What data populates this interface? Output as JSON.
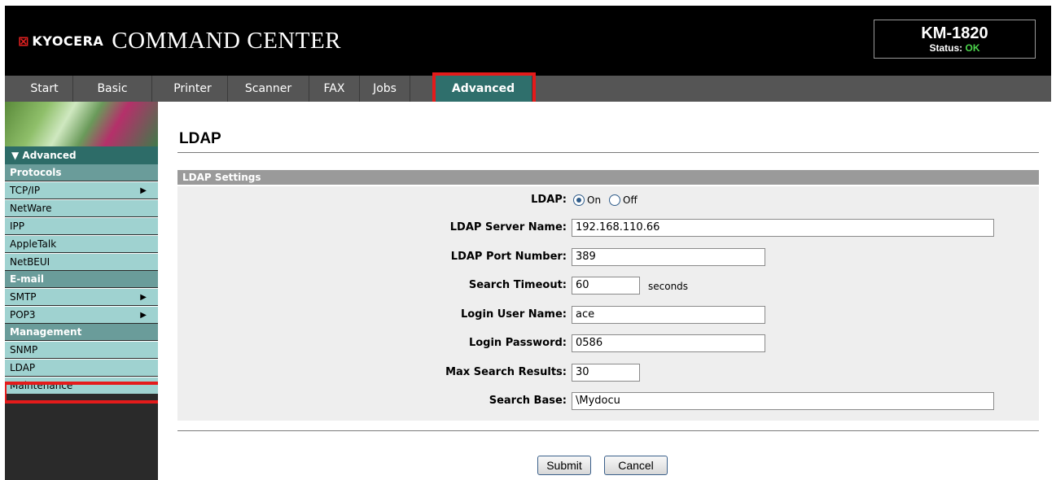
{
  "header": {
    "brand_mark": "⊠",
    "brand_name": "KYOCERA",
    "product_name": "COMMAND CENTER",
    "model": "KM-1820",
    "status_label": "Status:",
    "status_value": "OK",
    "status_color": "#4cd64c"
  },
  "tabs": [
    {
      "label": "Start"
    },
    {
      "label": "Basic"
    },
    {
      "label": "Printer"
    },
    {
      "label": "Scanner"
    },
    {
      "label": "FAX"
    },
    {
      "label": "Jobs"
    },
    {
      "label": "Advanced",
      "active": true
    }
  ],
  "sidebar": {
    "current_group": "▼ Advanced",
    "sections": {
      "protocols": "Protocols",
      "email": "E-mail",
      "management": "Management"
    },
    "items": {
      "tcpip": "TCP/IP",
      "netware": "NetWare",
      "ipp": "IPP",
      "appletalk": "AppleTalk",
      "netbeui": "NetBEUI",
      "smtp": "SMTP",
      "pop3": "POP3",
      "snmp": "SNMP",
      "ldap": "LDAP",
      "maintenance": "Maintenance"
    },
    "submenu_arrow": "▶"
  },
  "main": {
    "title": "LDAP",
    "section_header": "LDAP Settings",
    "form": {
      "ldap_label": "LDAP:",
      "ldap_on": "On",
      "ldap_off": "Off",
      "ldap_selected": "On",
      "server_label": "LDAP Server Name:",
      "server_value": "192.168.110.66",
      "port_label": "LDAP Port Number:",
      "port_value": "389",
      "timeout_label": "Search Timeout:",
      "timeout_value": "60",
      "timeout_unit": "seconds",
      "user_label": "Login User Name:",
      "user_value": "ace",
      "password_label": "Login Password:",
      "password_value": "0586",
      "max_label": "Max Search Results:",
      "max_value": "30",
      "base_label": "Search Base:",
      "base_value": "\\Mydocu"
    },
    "buttons": {
      "submit": "Submit",
      "cancel": "Cancel"
    }
  },
  "colors": {
    "highlight": "#e41b1b",
    "active_tab": "#2f6f6c",
    "sidebar_item": "#9fd2d0",
    "sidebar_section": "#6a9c9a"
  }
}
